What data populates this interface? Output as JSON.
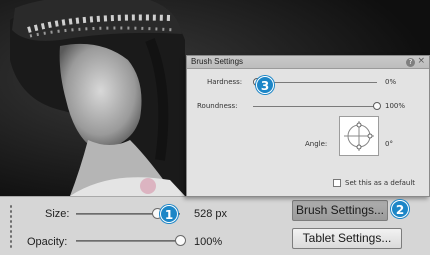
{
  "brush_settings_panel": {
    "title": "Brush Settings",
    "hardness": {
      "label": "Hardness:",
      "value": "0%",
      "level": 0.0
    },
    "roundness": {
      "label": "Roundness:",
      "value": "100%",
      "level": 1.0
    },
    "angle": {
      "label": "Angle:",
      "value": "0°"
    },
    "default_checkbox": {
      "label": "Set this as a default",
      "checked": false
    }
  },
  "options_bar": {
    "size": {
      "label": "Size:",
      "value": "528 px",
      "level": 0.78
    },
    "opacity": {
      "label": "Opacity:",
      "value": "100%",
      "level": 1.0
    },
    "brush_settings_button": "Brush Settings...",
    "tablet_settings_button": "Tablet Settings..."
  },
  "callouts": [
    "1",
    "2",
    "3"
  ],
  "colors": {
    "callout_blue": "#1c86c7",
    "panel_bg": "#e3e3e3",
    "options_bg": "#d6d6d6"
  }
}
